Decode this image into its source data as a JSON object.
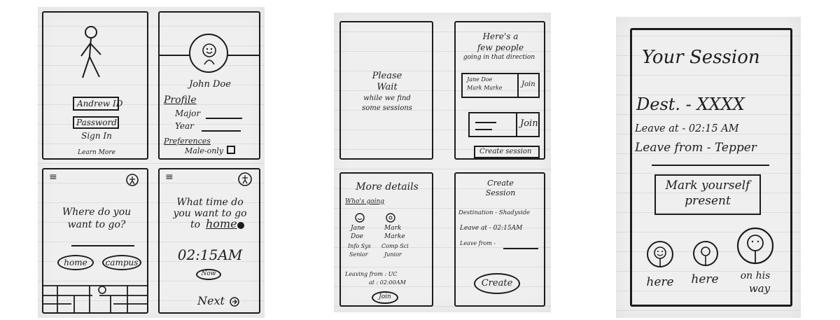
{
  "sketch1": {
    "login": {
      "andrew_id": "Andrew ID",
      "password": "Password",
      "sign_in": "Sign In",
      "learn_more": "Learn More"
    },
    "profile": {
      "name": "John Doe",
      "profile": "Profile",
      "major": "Major",
      "year": "Year",
      "preferences": "Preferences",
      "male_only": "Male-only"
    },
    "where": {
      "question_line1": "Where do you",
      "question_line2": "want to go?",
      "home": "home",
      "campus": "campus"
    },
    "time": {
      "q1": "What time do",
      "q2": "you want to go",
      "q3_prefix": "to",
      "q3_link": "home",
      "time": "02:15AM",
      "now": "Now",
      "next": "Next"
    }
  },
  "sketch2": {
    "wait": {
      "l1": "Please",
      "l2": "Wait",
      "l3": "while we find",
      "l4": "some sessions"
    },
    "people": {
      "h1": "Here's a",
      "h2": "few people",
      "h3": "going in that direction",
      "names1": "Jane Doe",
      "names2": "Mark Marke",
      "join1": "Join",
      "join2": "Join",
      "create": "Create session"
    },
    "details": {
      "title": "More details",
      "whos": "Who's going",
      "p1a": "Jane",
      "p1b": "Doe",
      "p1c": "Info Sys",
      "p1d": "Senior",
      "p2a": "Mark",
      "p2b": "Marke",
      "p2c": "Comp Sci",
      "p2d": "Junior",
      "leaving1": "Leaving from : UC",
      "leaving2": "at : 02:00AM",
      "join": "Join"
    },
    "create": {
      "t1": "Create",
      "t2": "Session",
      "dest": "Destination - Shadyside",
      "leave": "Leave at - 02:15AM",
      "from": "Leave from -",
      "button": "Create"
    }
  },
  "sketch3": {
    "title": "Your Session",
    "dest": "Dest. - XXXX",
    "leave_at": "Leave at - 02:15 AM",
    "leave_from": "Leave from - Tepper",
    "button1": "Mark yourself",
    "button2": "present",
    "s1": "here",
    "s2": "here",
    "s3a": "on his",
    "s3b": "way"
  }
}
